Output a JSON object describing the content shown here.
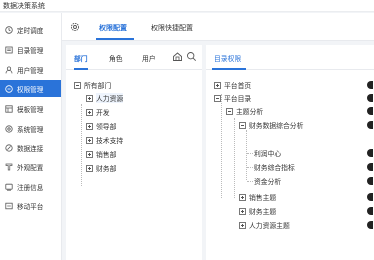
{
  "app": {
    "title": "数据决策系统"
  },
  "sidebar": {
    "items": [
      {
        "label": "定时调度",
        "icon": "clock-icon"
      },
      {
        "label": "目录管理",
        "icon": "folder-icon"
      },
      {
        "label": "用户管理",
        "icon": "user-icon"
      },
      {
        "label": "权限管理",
        "icon": "shield-icon",
        "active": true
      },
      {
        "label": "模板管理",
        "icon": "template-icon"
      },
      {
        "label": "系统管理",
        "icon": "settings-icon"
      },
      {
        "label": "数据连接",
        "icon": "link-icon"
      },
      {
        "label": "外观配置",
        "icon": "palette-icon"
      },
      {
        "label": "注册信息",
        "icon": "registration-icon"
      },
      {
        "label": "移动平台",
        "icon": "mobile-icon"
      }
    ]
  },
  "main": {
    "tabs": [
      {
        "label": "权限配置",
        "active": true
      },
      {
        "label": "权限快捷配置"
      }
    ]
  },
  "left_panel": {
    "subtabs": [
      {
        "label": "部门",
        "active": true
      },
      {
        "label": "角色"
      },
      {
        "label": "用户"
      }
    ],
    "tree": {
      "root": "所有部门",
      "children": [
        "人力资源",
        "开发",
        "领导部",
        "技术支持",
        "销售部",
        "财务部"
      ],
      "selected": "人力资源"
    }
  },
  "right_panel": {
    "title": "目录权限",
    "tree": {
      "platform_home": "平台首页",
      "platform_directory": "平台目录",
      "topic_analysis": "主题分析",
      "finance_analysis": "财务数据综合分析",
      "profit_center": "利润中心",
      "finance_indicators": "财务综合指标",
      "fund_analysis": "资金分析",
      "sales_topic": "销售主题",
      "finance_topic": "财务主题",
      "hr_topic": "人力资源主题"
    }
  },
  "colors": {
    "accent": "#2a73d9",
    "background": "#f2f4f7",
    "panel": "#ffffff"
  }
}
